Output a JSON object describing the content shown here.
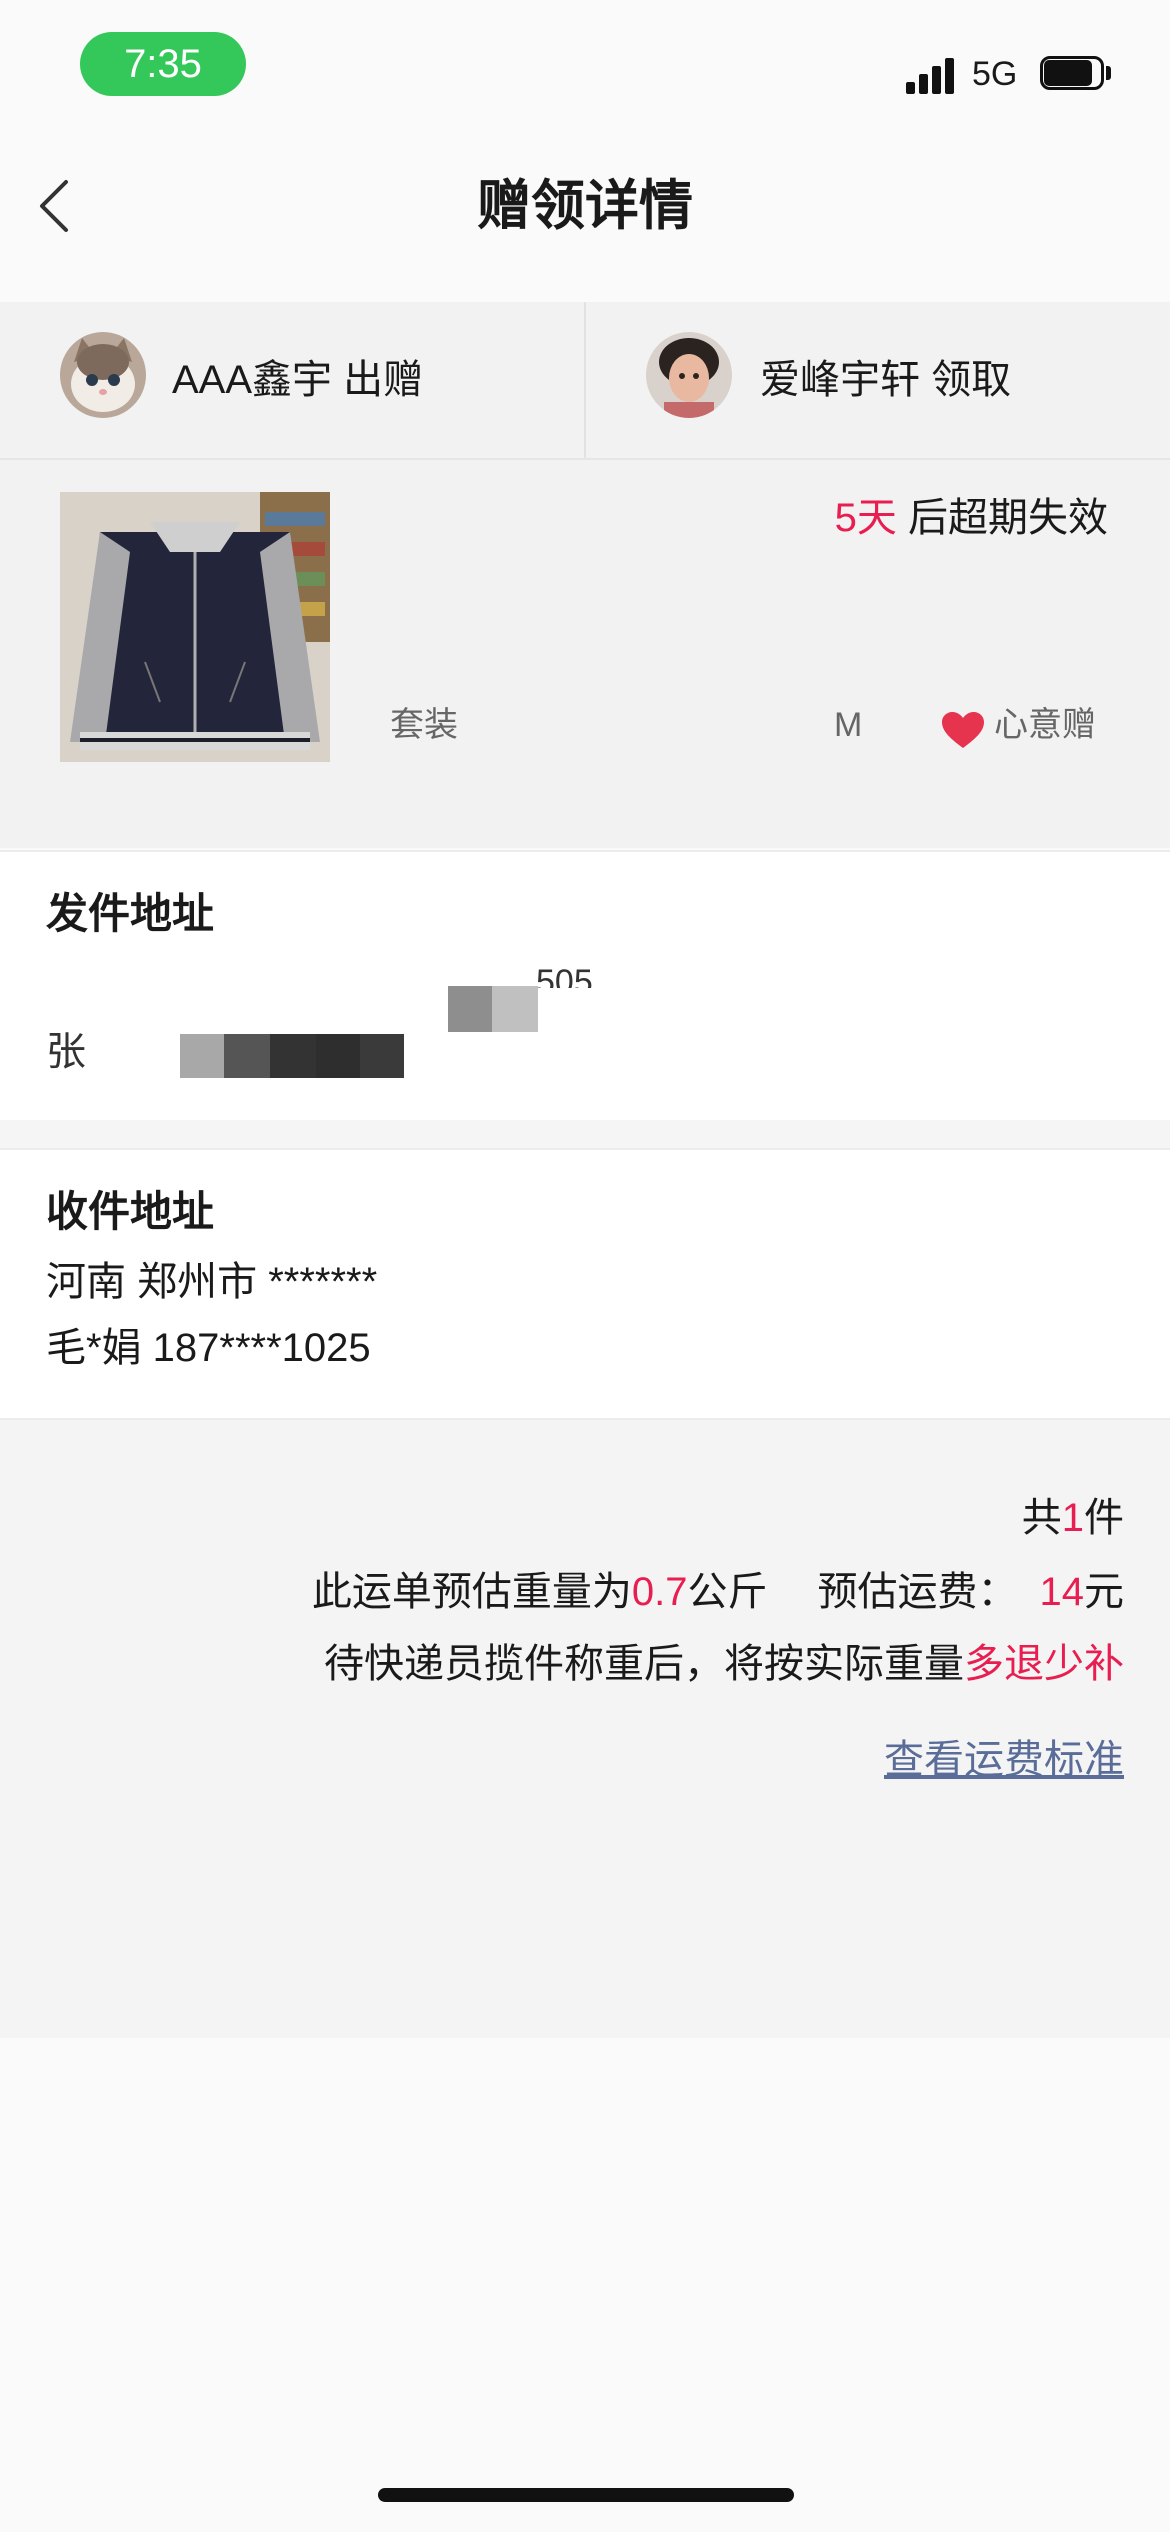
{
  "status_bar": {
    "time": "7:35",
    "network": "5G"
  },
  "nav": {
    "title": "赠领详情"
  },
  "parties": {
    "giver": {
      "name": "AAA鑫宇 出赠"
    },
    "receiver": {
      "name": "爱峰宇轩 领取"
    }
  },
  "item": {
    "expiry_days": "5天",
    "expiry_suffix": " 后超期失效",
    "name": "套装",
    "size": "M",
    "gift_type": "心意赠"
  },
  "sender_address": {
    "title": "发件地址",
    "name_visible": "张",
    "phone_fragment": "505"
  },
  "receiver_address": {
    "title": "收件地址",
    "region": "河南 郑州市 *******",
    "contact": "毛*娟 187****1025"
  },
  "shipping": {
    "count_prefix": "共",
    "count": "1",
    "count_suffix": "件",
    "weight_prefix": "此运单预估重量为",
    "weight": "0.7",
    "weight_unit": "公斤",
    "fee_label": "预估运费：",
    "fee": "14",
    "fee_unit": "元",
    "note_prefix": "待快递员揽件称重后，将按实际重量",
    "note_highlight": "多退少补",
    "fee_standard_link": "查看运费标准"
  },
  "colors": {
    "accent_red": "#e91e50",
    "status_green": "#34c759",
    "link": "#5a6d99"
  }
}
